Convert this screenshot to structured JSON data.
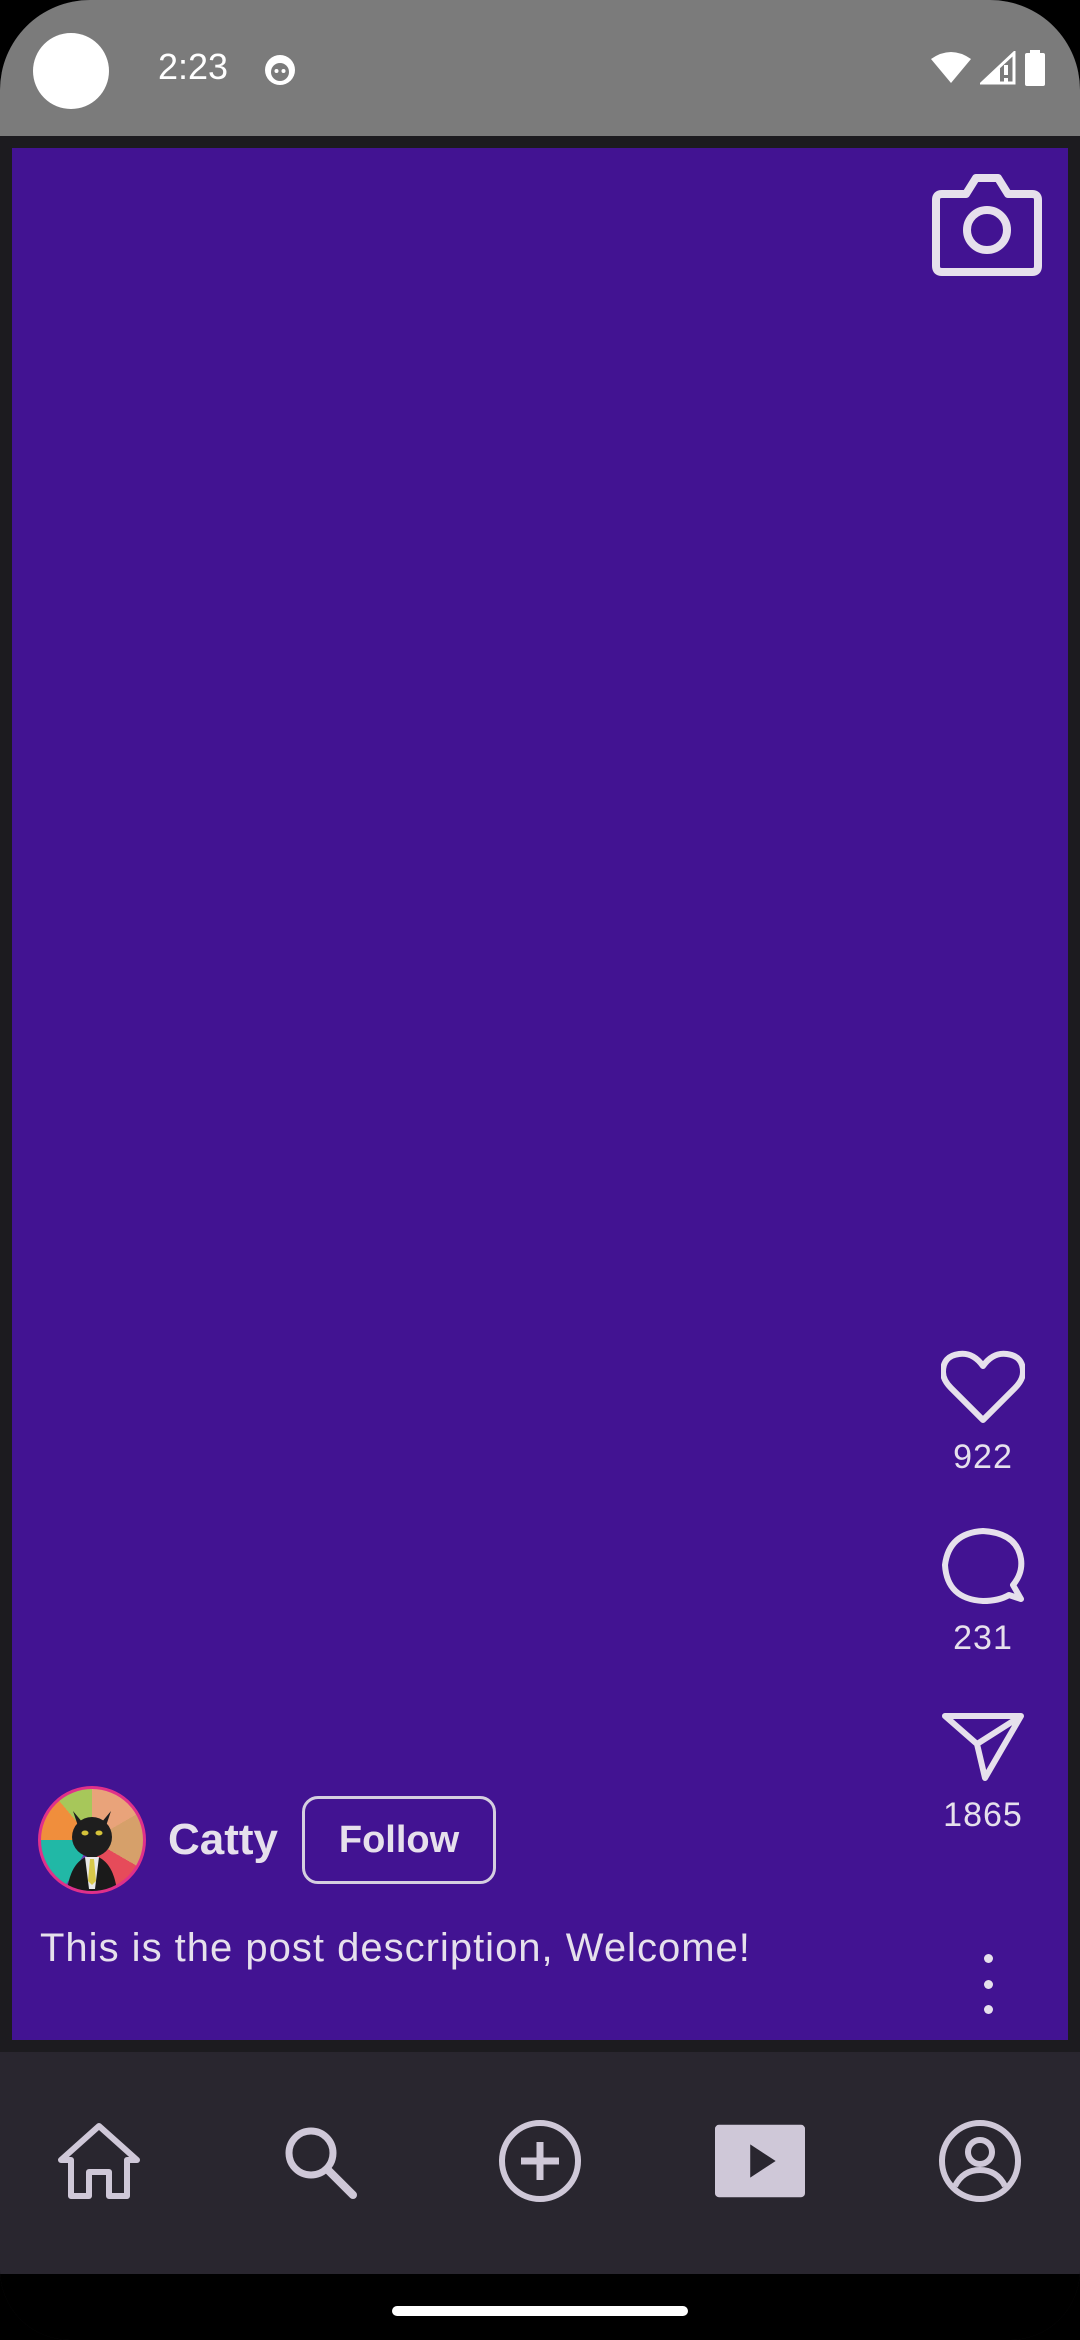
{
  "status_bar": {
    "time": "2:23",
    "icons": [
      "wifi-icon",
      "signal-icon",
      "battery-icon"
    ]
  },
  "reel": {
    "background_color": "#421392",
    "camera_icon": "camera-icon",
    "actions": {
      "like_count": "922",
      "comment_count": "231",
      "share_count": "1865"
    },
    "author": {
      "name": "Catty",
      "follow_label": "Follow"
    },
    "description": "This is the post description, Welcome!"
  },
  "bottom_nav": {
    "items": [
      "home-icon",
      "search-icon",
      "add-icon",
      "reels-icon",
      "profile-icon"
    ],
    "selected": "reels-icon"
  },
  "colors": {
    "accent": "#421392",
    "on_surface": "#e6e0ec",
    "nav_background": "#29262f"
  }
}
